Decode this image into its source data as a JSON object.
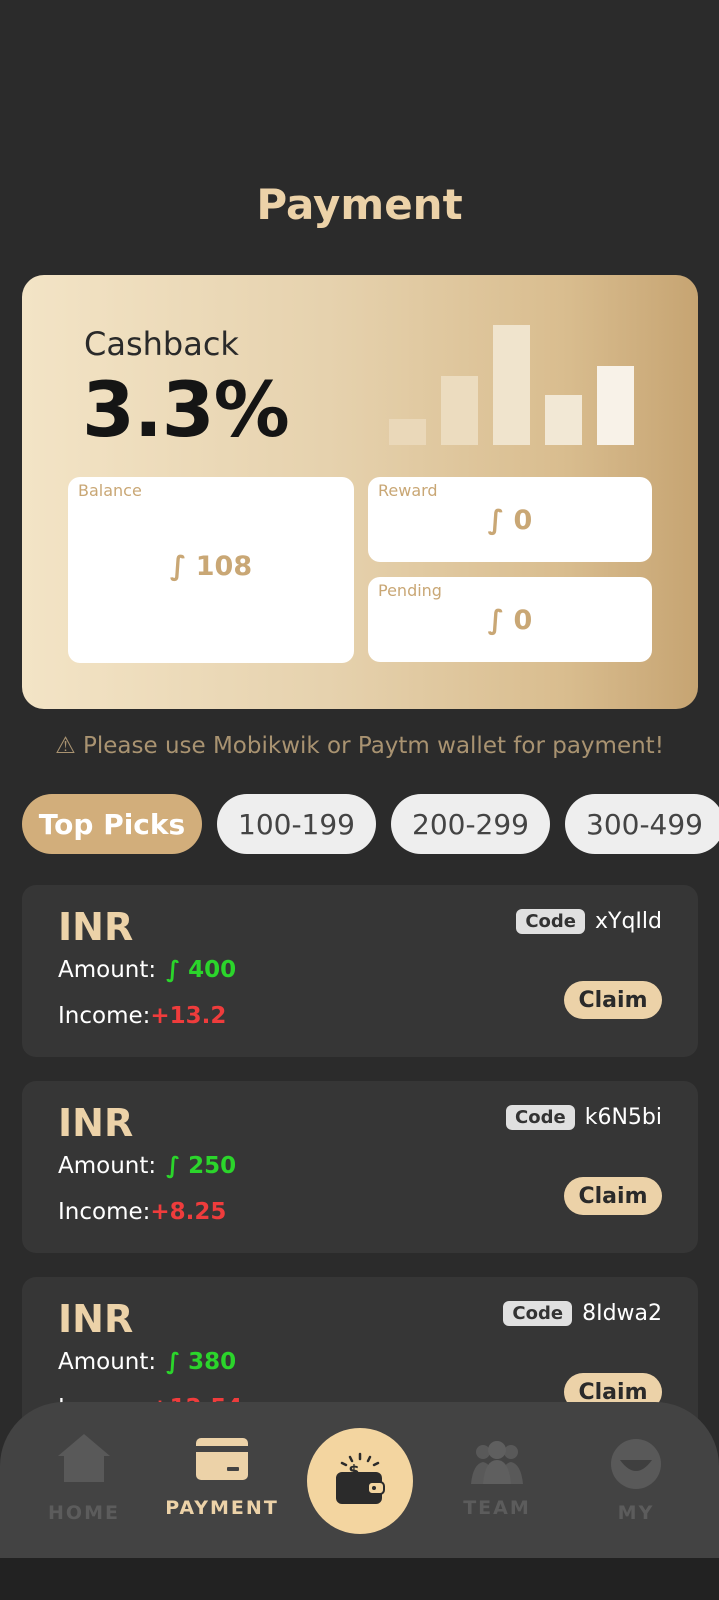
{
  "page": {
    "title": "Payment"
  },
  "hero": {
    "cashback_label": "Cashback",
    "cashback_value": "3.3%",
    "balance": {
      "label": "Balance",
      "value": "∫ 108"
    },
    "reward": {
      "label": "Reward",
      "value": "∫ 0"
    },
    "pending": {
      "label": "Pending",
      "value": "∫ 0"
    }
  },
  "notice": "⚠ Please use Mobikwik or Paytm wallet for payment!",
  "filters": [
    {
      "label": "Top Picks",
      "active": true
    },
    {
      "label": "100-199",
      "active": false
    },
    {
      "label": "200-299",
      "active": false
    },
    {
      "label": "300-499",
      "active": false
    }
  ],
  "orders": [
    {
      "currency": "INR",
      "amount_label": "Amount:",
      "amount": "∫ 400",
      "income_label": "Income:",
      "income": "+13.2",
      "code_label": "Code",
      "code": "xYqIld",
      "claim": "Claim"
    },
    {
      "currency": "INR",
      "amount_label": "Amount:",
      "amount": "∫ 250",
      "income_label": "Income:",
      "income": "+8.25",
      "code_label": "Code",
      "code": "k6N5bi",
      "claim": "Claim"
    },
    {
      "currency": "INR",
      "amount_label": "Amount:",
      "amount": "∫ 380",
      "income_label": "Income:",
      "income": "+12.54",
      "code_label": "Code",
      "code": "8Idwa2",
      "claim": "Claim"
    }
  ],
  "nav": {
    "home": "HOME",
    "payment": "PAYMENT",
    "team": "TEAM",
    "my": "MY",
    "active": "payment"
  },
  "colors": {
    "accent": "#ecd2a8",
    "amount": "#2bd52b",
    "income": "#ef3c3c"
  }
}
